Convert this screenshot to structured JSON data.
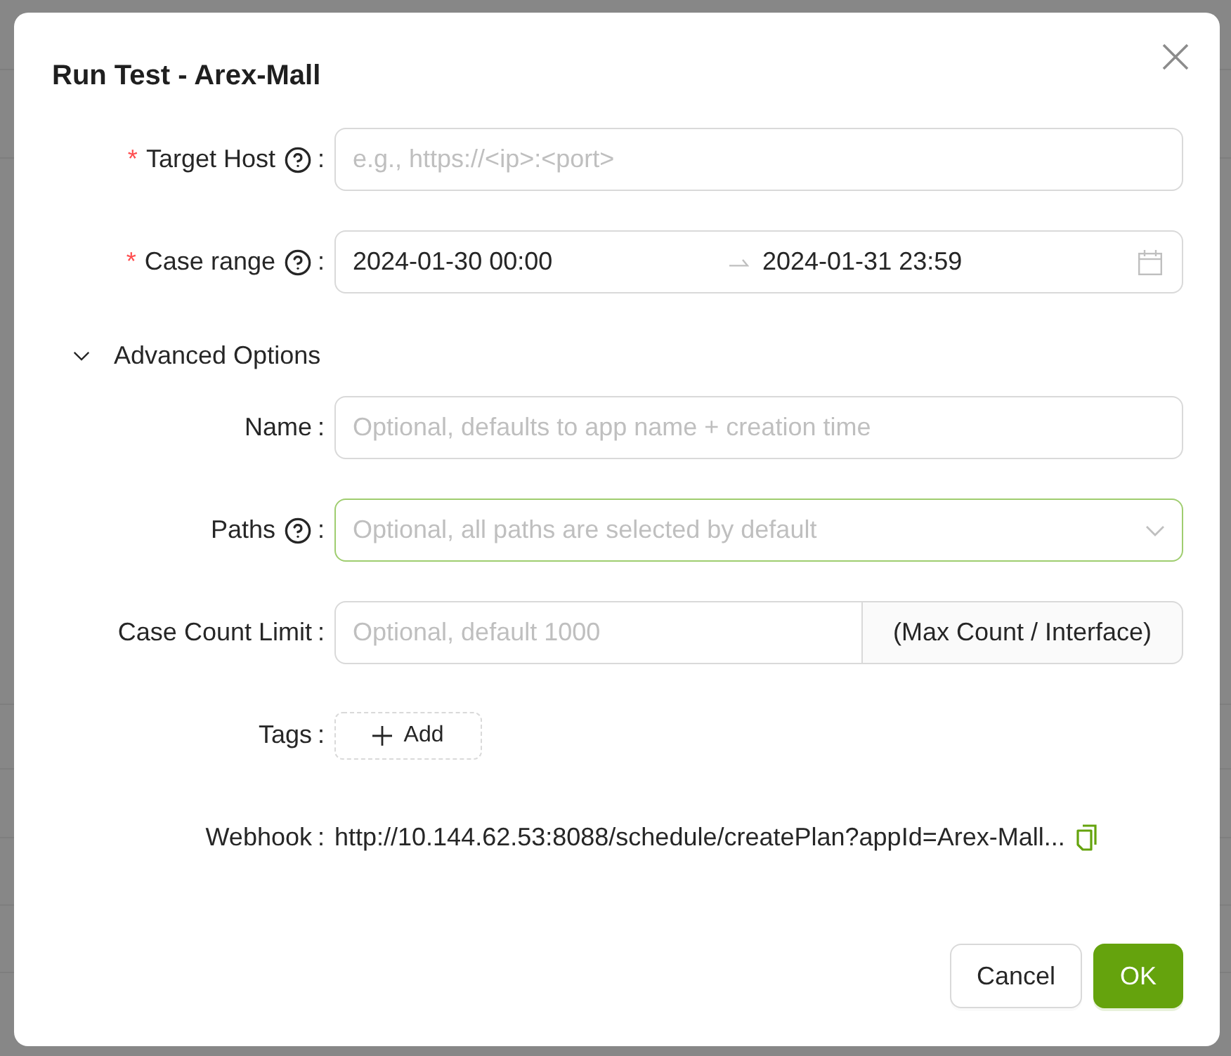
{
  "dialog": {
    "title": "Run Test - Arex-Mall"
  },
  "fields": [
    {
      "kind": "input",
      "mark": "*",
      "label": "Target Host",
      "help": true,
      "colon": ":",
      "focused": false,
      "placeholder": "e.g., https://<ip>:<port>"
    },
    {
      "kind": "date_range",
      "mark": "*",
      "label": "Case range",
      "help": true,
      "colon": ":",
      "focused": false,
      "start": "2024-01-30 00:00",
      "end": "2024-01-31 23:59"
    }
  ],
  "advanced": {
    "label": "Advanced Options",
    "expanded": true,
    "fields": [
      {
        "kind": "input",
        "label": "Name",
        "help": false,
        "colon": ":",
        "focused": false,
        "placeholder": "Optional, defaults to app name + creation time"
      },
      {
        "kind": "select",
        "label": "Paths",
        "help": true,
        "colon": ":",
        "focused": true,
        "placeholder": "Optional, all paths are selected by default"
      },
      {
        "kind": "input_addon",
        "label": "Case Count Limit",
        "help": false,
        "colon": ":",
        "focused": false,
        "placeholder": "Optional, default 1000",
        "addon": "(Max Count / Interface)"
      },
      {
        "kind": "tags",
        "label": "Tags",
        "help": false,
        "colon": ":",
        "button": "Add"
      },
      {
        "kind": "text",
        "label": "Webhook",
        "help": false,
        "colon": ":",
        "value": "http://10.144.62.53:8088/schedule/createPlan?appId=Arex-Mall..."
      }
    ]
  },
  "buttons": [
    {
      "label": "Cancel",
      "kind": "default"
    },
    {
      "label": "OK",
      "kind": "primary"
    }
  ]
}
